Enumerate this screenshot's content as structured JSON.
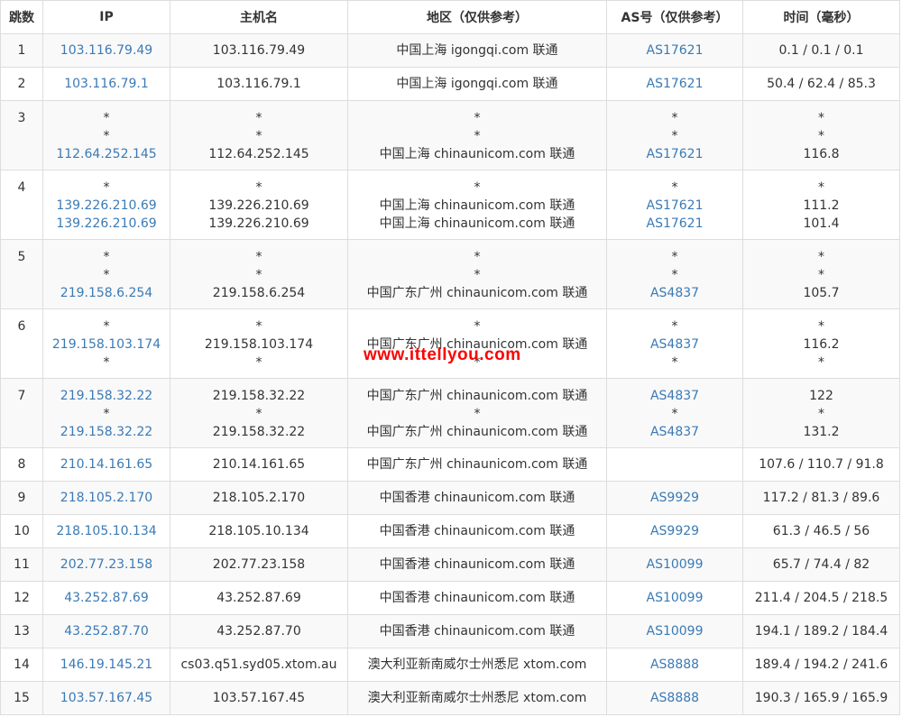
{
  "headers": [
    "跳数",
    "IP",
    "主机名",
    "地区（仅供参考）",
    "AS号（仅供参考）",
    "时间（毫秒）"
  ],
  "rows": [
    {
      "hop": "1",
      "ip": [
        "103.116.79.49"
      ],
      "host": [
        "103.116.79.49"
      ],
      "region": [
        "中国上海 igongqi.com 联通"
      ],
      "as": [
        "AS17621"
      ],
      "time": [
        "0.1 / 0.1 / 0.1"
      ]
    },
    {
      "hop": "2",
      "ip": [
        "103.116.79.1"
      ],
      "host": [
        "103.116.79.1"
      ],
      "region": [
        "中国上海 igongqi.com 联通"
      ],
      "as": [
        "AS17621"
      ],
      "time": [
        "50.4 / 62.4 / 85.3"
      ]
    },
    {
      "hop": "3",
      "ip": [
        "*",
        "*",
        "112.64.252.145"
      ],
      "host": [
        "*",
        "*",
        "112.64.252.145"
      ],
      "region": [
        "*",
        "*",
        "中国上海 chinaunicom.com 联通"
      ],
      "as": [
        "*",
        "*",
        "AS17621"
      ],
      "time": [
        "*",
        "*",
        "116.8"
      ]
    },
    {
      "hop": "4",
      "ip": [
        "*",
        "139.226.210.69",
        "139.226.210.69"
      ],
      "host": [
        "*",
        "139.226.210.69",
        "139.226.210.69"
      ],
      "region": [
        "*",
        "中国上海 chinaunicom.com 联通",
        "中国上海 chinaunicom.com 联通"
      ],
      "as": [
        "*",
        "AS17621",
        "AS17621"
      ],
      "time": [
        "*",
        "111.2",
        "101.4"
      ]
    },
    {
      "hop": "5",
      "ip": [
        "*",
        "*",
        "219.158.6.254"
      ],
      "host": [
        "*",
        "*",
        "219.158.6.254"
      ],
      "region": [
        "*",
        "*",
        "中国广东广州 chinaunicom.com 联通"
      ],
      "as": [
        "*",
        "*",
        "AS4837"
      ],
      "time": [
        "*",
        "*",
        "105.7"
      ]
    },
    {
      "hop": "6",
      "ip": [
        "*",
        "219.158.103.174",
        "*"
      ],
      "host": [
        "*",
        "219.158.103.174",
        "*"
      ],
      "region": [
        "*",
        "中国广东广州 chinaunicom.com 联通",
        "*"
      ],
      "as": [
        "*",
        "AS4837",
        "*"
      ],
      "time": [
        "*",
        "116.2",
        "*"
      ]
    },
    {
      "hop": "7",
      "ip": [
        "219.158.32.22",
        "*",
        "219.158.32.22"
      ],
      "host": [
        "219.158.32.22",
        "*",
        "219.158.32.22"
      ],
      "region": [
        "中国广东广州 chinaunicom.com 联通",
        "*",
        "中国广东广州 chinaunicom.com 联通"
      ],
      "as": [
        "AS4837",
        "*",
        "AS4837"
      ],
      "time": [
        "122",
        "*",
        "131.2"
      ]
    },
    {
      "hop": "8",
      "ip": [
        "210.14.161.65"
      ],
      "host": [
        "210.14.161.65"
      ],
      "region": [
        "中国广东广州 chinaunicom.com 联通"
      ],
      "as": [
        ""
      ],
      "time": [
        "107.6 / 110.7 / 91.8"
      ]
    },
    {
      "hop": "9",
      "ip": [
        "218.105.2.170"
      ],
      "host": [
        "218.105.2.170"
      ],
      "region": [
        "中国香港 chinaunicom.com 联通"
      ],
      "as": [
        "AS9929"
      ],
      "time": [
        "117.2 / 81.3 / 89.6"
      ]
    },
    {
      "hop": "10",
      "ip": [
        "218.105.10.134"
      ],
      "host": [
        "218.105.10.134"
      ],
      "region": [
        "中国香港 chinaunicom.com 联通"
      ],
      "as": [
        "AS9929"
      ],
      "time": [
        "61.3 / 46.5 / 56"
      ]
    },
    {
      "hop": "11",
      "ip": [
        "202.77.23.158"
      ],
      "host": [
        "202.77.23.158"
      ],
      "region": [
        "中国香港 chinaunicom.com 联通"
      ],
      "as": [
        "AS10099"
      ],
      "time": [
        "65.7 / 74.4 / 82"
      ]
    },
    {
      "hop": "12",
      "ip": [
        "43.252.87.69"
      ],
      "host": [
        "43.252.87.69"
      ],
      "region": [
        "中国香港 chinaunicom.com 联通"
      ],
      "as": [
        "AS10099"
      ],
      "time": [
        "211.4 / 204.5 / 218.5"
      ]
    },
    {
      "hop": "13",
      "ip": [
        "43.252.87.70"
      ],
      "host": [
        "43.252.87.70"
      ],
      "region": [
        "中国香港 chinaunicom.com 联通"
      ],
      "as": [
        "AS10099"
      ],
      "time": [
        "194.1 / 189.2 / 184.4"
      ]
    },
    {
      "hop": "14",
      "ip": [
        "146.19.145.21"
      ],
      "host": [
        "cs03.q51.syd05.xtom.au"
      ],
      "region": [
        "澳大利亚新南威尔士州悉尼 xtom.com"
      ],
      "as": [
        "AS8888"
      ],
      "time": [
        "189.4 / 194.2 / 241.6"
      ]
    },
    {
      "hop": "15",
      "ip": [
        "103.57.167.45"
      ],
      "host": [
        "103.57.167.45"
      ],
      "region": [
        "澳大利亚新南威尔士州悉尼 xtom.com"
      ],
      "as": [
        "AS8888"
      ],
      "time": [
        "190.3 / 165.9 / 165.9"
      ]
    }
  ],
  "watermark": "www.ittellyou.com",
  "colors": {
    "link": "#3a7ab5",
    "border": "#dddddd",
    "stripe": "#f9f9f9",
    "watermark": "#ff0000"
  }
}
